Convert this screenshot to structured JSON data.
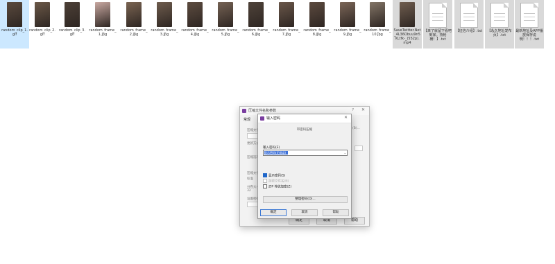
{
  "files": [
    {
      "name": "random_clip_1.gif",
      "kind": "thumb",
      "color": "#5a4a3e",
      "selected": "blue"
    },
    {
      "name": "random_clip_2.gif",
      "kind": "thumb",
      "color": "#6b5847"
    },
    {
      "name": "random_clip_3.gif",
      "kind": "thumb",
      "color": "#4d4037"
    },
    {
      "name": "random_frame_1.jpg",
      "kind": "thumb",
      "color": "#c9a9a2"
    },
    {
      "name": "random_frame_2.jpg",
      "kind": "thumb",
      "color": "#7a6452"
    },
    {
      "name": "random_frame_3.jpg",
      "kind": "thumb",
      "color": "#6e5c4d"
    },
    {
      "name": "random_frame_4.jpg",
      "kind": "thumb",
      "color": "#5d4c40"
    },
    {
      "name": "random_frame_5.jpg",
      "kind": "thumb",
      "color": "#756254"
    },
    {
      "name": "random_frame_6.jpg",
      "kind": "thumb",
      "color": "#4f433a"
    },
    {
      "name": "random_frame_7.jpg",
      "kind": "thumb",
      "color": "#6a574a"
    },
    {
      "name": "random_frame_8.jpg",
      "kind": "thumb",
      "color": "#5c4a3f"
    },
    {
      "name": "random_frame_9.jpg",
      "kind": "thumb",
      "color": "#7b6658"
    },
    {
      "name": "random_frame_10.jpg",
      "kind": "thumb",
      "color": "#827466"
    },
    {
      "name": "SaveTwitter.Net_4L36Obuu9n5XLtfk-_(552p).mp4",
      "kind": "thumb",
      "color": "#6f5d4f",
      "selected": "gray"
    },
    {
      "name": "【来了就留下看吧到家。持枪横！】.txt",
      "kind": "doc",
      "selected": "gray"
    },
    {
      "name": "【征信介绍】.txt",
      "kind": "doc",
      "selected": "gray"
    },
    {
      "name": "【永久地址发布页】.txt",
      "kind": "doc",
      "selected": "gray"
    },
    {
      "name": "最新地址及APP播放保存说明！！！.txt",
      "kind": "doc",
      "selected": "gray"
    }
  ],
  "outer_dialog": {
    "title": "压缩文件名和参数",
    "help": "?",
    "close": "✕",
    "tab": "常规",
    "ok": "确定",
    "cancel": "取消",
    "help_btn": "帮助",
    "ghost_labels": [
      "压缩文件",
      "...",
      "更新方式",
      "压缩选项",
      "压缩文件格式",
      "标准",
      "分卷大小",
      "32",
      "设置密码",
      "(B)..."
    ]
  },
  "password_dialog": {
    "title": "输入密码",
    "close": "✕",
    "archive_name": "带密码压缩",
    "password_label": "输入密码(E)",
    "password_value": "显示密码(无错误)",
    "dropdown_arrow": "⌄",
    "cb_show": "显示密码(S)",
    "cb_encrypt_names": "加密文件名(N)",
    "cb_zip_legacy": "ZIP 传统加密(Z)",
    "organize": "整理密码(O)...",
    "ok": "确定",
    "cancel": "取消",
    "help": "帮助"
  }
}
